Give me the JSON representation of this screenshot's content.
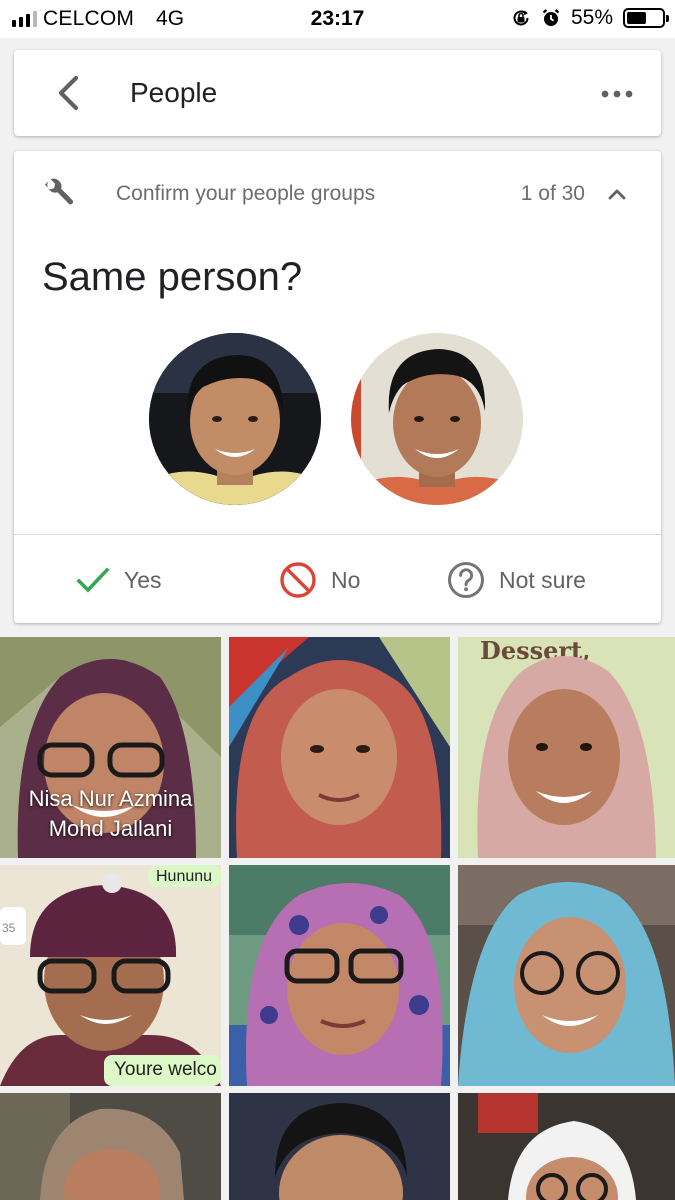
{
  "status_bar": {
    "carrier": "CELCOM",
    "network": "4G",
    "time": "23:17",
    "battery": "55%",
    "battery_level": 0.55
  },
  "app_bar": {
    "title": "People"
  },
  "confirm_card": {
    "title": "Confirm your people groups",
    "counter": "1 of 30",
    "question": "Same person?",
    "answers": {
      "yes": "Yes",
      "no": "No",
      "not_sure": "Not sure"
    }
  },
  "grid": {
    "tiles": [
      {
        "caption_line1": "Nisa Nur Azmina",
        "caption_line2": "Mohd Jallani"
      },
      {
        "caption_line1": "",
        "caption_line2": ""
      },
      {
        "caption_line1": "",
        "caption_line2": ""
      },
      {
        "caption_line1": "",
        "caption_line2": ""
      },
      {
        "caption_line1": "",
        "caption_line2": ""
      },
      {
        "caption_line1": "",
        "caption_line2": ""
      },
      {
        "caption_line1": "",
        "caption_line2": ""
      },
      {
        "caption_line1": "",
        "caption_line2": ""
      },
      {
        "caption_line1": "",
        "caption_line2": ""
      }
    ],
    "photo_text": {
      "dessert_sign": "Dessert,",
      "chat_bubble": "Youre welco",
      "sticker_top": "Hununu",
      "badge_number": "35"
    }
  },
  "colors": {
    "accent_yes": "#34a853",
    "accent_no": "#db4437",
    "muted_icon": "#757575",
    "background": "#f1f1f1"
  }
}
